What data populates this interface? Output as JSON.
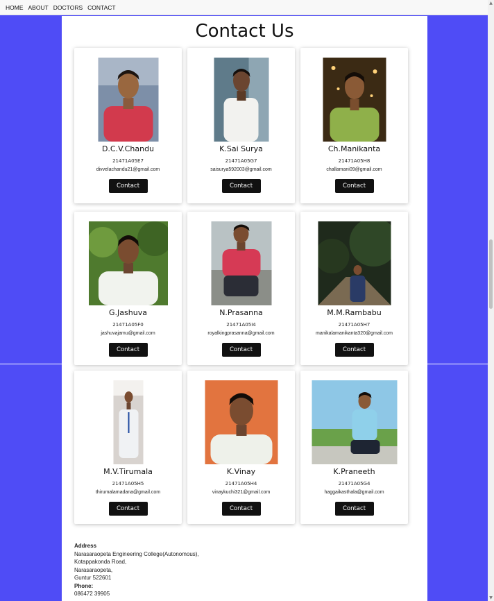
{
  "nav": {
    "items": [
      "HOME",
      "ABOUT",
      "DOCTORS",
      "CONTACT"
    ]
  },
  "page": {
    "title": "Contact Us"
  },
  "contacts": [
    {
      "name": "D.C.V.Chandu",
      "id": "21471A05E7",
      "email": "divvelachandu21@gmail.com",
      "button": "Contact"
    },
    {
      "name": "K.Sai Surya",
      "id": "21471A05G7",
      "email": "saisurya592003@gmail.com",
      "button": "Contact"
    },
    {
      "name": "Ch.Manikanta",
      "id": "21471A05H8",
      "email": "challamani09@gmail.com",
      "button": "Contact"
    },
    {
      "name": "G.Jashuva",
      "id": "21471A05F0",
      "email": "jashuvajamu@gmail.com",
      "button": "Contact"
    },
    {
      "name": "N.Prasanna",
      "id": "21471A05I4",
      "email": "royalkingprasanna@gmail.com",
      "button": "Contact"
    },
    {
      "name": "M.M.Rambabu",
      "id": "21471A05H7",
      "email": "manikalamanikanta320@gmail.com",
      "button": "Contact"
    },
    {
      "name": "M.V.Tirumala",
      "id": "21471A05H5",
      "email": "thirumalamadana@gmail.com",
      "button": "Contact"
    },
    {
      "name": "K.Vinay",
      "id": "21471A05H4",
      "email": "vinaykuchi321@gmail.com",
      "button": "Contact"
    },
    {
      "name": "K.Praneeth",
      "id": "21471A05G4",
      "email": "haggaikasthala@gmail.com",
      "button": "Contact"
    }
  ],
  "address": {
    "label": "Address",
    "lines": [
      "Narasaraopeta Engineering College(Autonomous),",
      "Kotappakonda Road,",
      "Narasaraopeta,",
      "Guntur 522601"
    ],
    "phone_label": "Phone:",
    "phone": "086472 39905"
  },
  "colors": {
    "background": "#4f4cf6",
    "panel": "#ffffff",
    "button": "#111111"
  }
}
